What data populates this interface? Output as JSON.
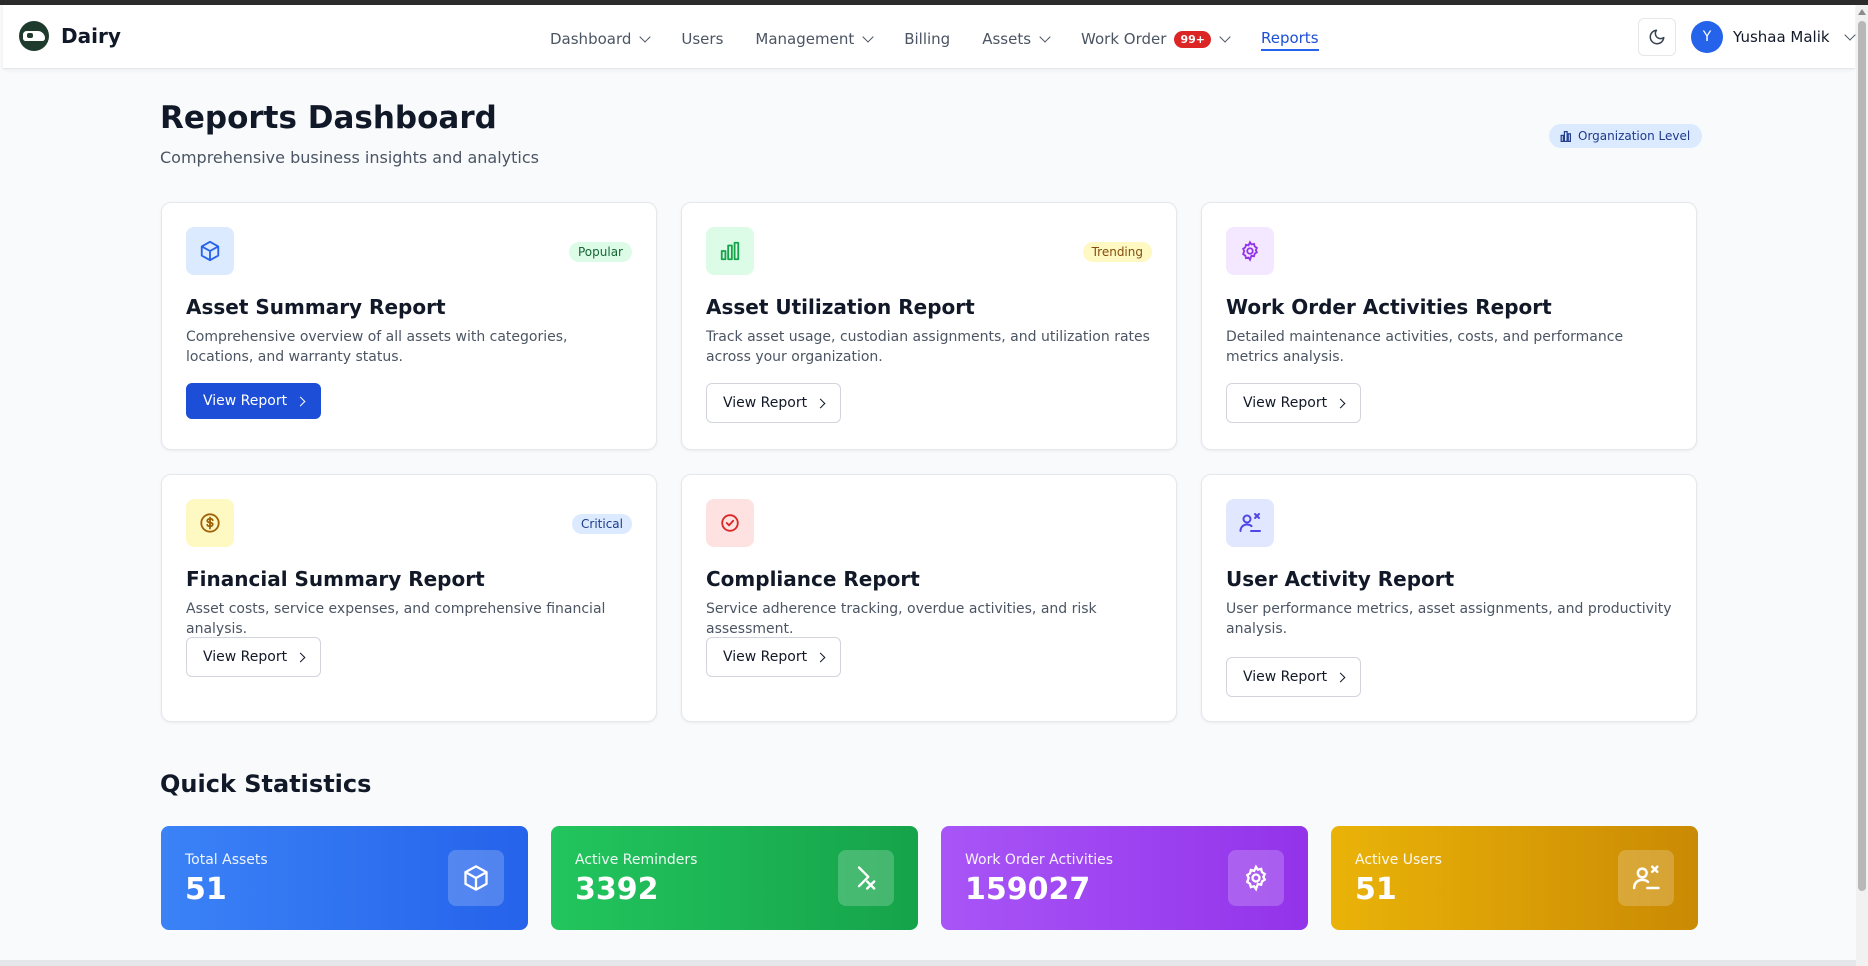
{
  "brand": {
    "name": "Dairy"
  },
  "nav": {
    "items": [
      {
        "label": "Dashboard",
        "dropdown": true
      },
      {
        "label": "Users",
        "dropdown": false
      },
      {
        "label": "Management",
        "dropdown": true
      },
      {
        "label": "Billing",
        "dropdown": false
      },
      {
        "label": "Assets",
        "dropdown": true
      },
      {
        "label": "Work Order",
        "dropdown": true,
        "badge": "99+"
      },
      {
        "label": "Reports",
        "dropdown": false,
        "active": true
      }
    ]
  },
  "user": {
    "initial": "Y",
    "name": "Yushaa Malik"
  },
  "header": {
    "title": "Reports Dashboard",
    "subtitle": "Comprehensive business insights and analytics",
    "org_badge": "Organization Level"
  },
  "reports": [
    {
      "title": "Asset Summary Report",
      "description": "Comprehensive overview of all assets with categories, locations, and warranty status.",
      "tag": "Popular",
      "button": "View Report",
      "icon": "cube-icon",
      "icon_bg": "#dbeafe",
      "icon_color": "#2563eb",
      "tag_bg": "#dcfce7",
      "tag_color": "#166534",
      "primary": true
    },
    {
      "title": "Asset Utilization Report",
      "description": "Track asset usage, custodian assignments, and utilization rates across your organization.",
      "tag": "Trending",
      "button": "View Report",
      "icon": "bar-chart-icon",
      "icon_bg": "#dcfce7",
      "icon_color": "#16a34a",
      "tag_bg": "#fef9c3",
      "tag_color": "#854d0e",
      "primary": false
    },
    {
      "title": "Work Order Activities Report",
      "description": "Detailed maintenance activities, costs, and performance metrics analysis.",
      "tag": "",
      "button": "View Report",
      "icon": "gear-icon",
      "icon_bg": "#f3e8ff",
      "icon_color": "#9333ea",
      "primary": false
    },
    {
      "title": "Financial Summary Report",
      "description": "Asset costs, service expenses, and comprehensive financial analysis.",
      "tag": "Critical",
      "button": "View Report",
      "icon": "dollar-icon",
      "icon_bg": "#fef9c3",
      "icon_color": "#a16207",
      "tag_bg": "#dbeafe",
      "tag_color": "#1e3a8a",
      "primary": false
    },
    {
      "title": "Compliance Report",
      "description": "Service adherence tracking, overdue activities, and risk assessment.",
      "tag": "",
      "button": "View Report",
      "icon": "check-circle-icon",
      "icon_bg": "#fee2e2",
      "icon_color": "#dc2626",
      "primary": false
    },
    {
      "title": "User Activity Report",
      "description": "User performance metrics, asset assignments, and productivity analysis.",
      "tag": "",
      "button": "View Report",
      "icon": "user-cog-icon",
      "icon_bg": "#e0e7ff",
      "icon_color": "#4f46e5",
      "primary": false
    }
  ],
  "quick_stats": {
    "title": "Quick Statistics",
    "items": [
      {
        "label": "Total Assets",
        "value": "51",
        "icon": "cube-icon",
        "gradient": [
          "#3b82f6",
          "#2563eb"
        ]
      },
      {
        "label": "Active Reminders",
        "value": "3392",
        "icon": "reminder-icon",
        "gradient": [
          "#22c55e",
          "#16a34a"
        ]
      },
      {
        "label": "Work Order Activities",
        "value": "159027",
        "icon": "gear-icon",
        "gradient": [
          "#a855f7",
          "#9333ea"
        ]
      },
      {
        "label": "Active Users",
        "value": "51",
        "icon": "user-cog-icon",
        "gradient": [
          "#eab308",
          "#ca8a04"
        ]
      }
    ]
  }
}
